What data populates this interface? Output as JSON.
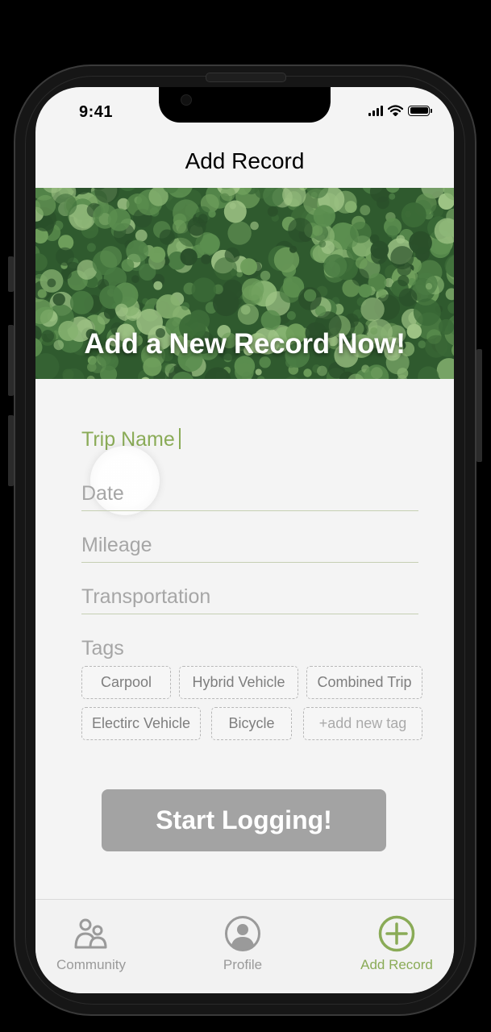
{
  "status_bar": {
    "time": "9:41"
  },
  "header": {
    "title": "Add Record"
  },
  "hero": {
    "title": "Add a New Record Now!"
  },
  "form": {
    "trip_name": {
      "placeholder": "Trip Name"
    },
    "date": {
      "placeholder": "Date"
    },
    "mileage": {
      "placeholder": "Mileage"
    },
    "transportation": {
      "placeholder": "Transportation"
    },
    "tags": {
      "label": "Tags",
      "items": [
        "Carpool",
        "Hybrid Vehicle",
        "Combined Trip",
        "Electirc Vehicle",
        "Bicycle"
      ],
      "add_label": "+add new tag"
    }
  },
  "cta": {
    "label": "Start Logging!"
  },
  "tab_bar": {
    "items": [
      {
        "label": "Community",
        "icon": "community-icon"
      },
      {
        "label": "Profile",
        "icon": "profile-icon"
      },
      {
        "label": "Add Record",
        "icon": "add-record-icon",
        "active": true
      }
    ]
  },
  "colors": {
    "accent": "#8aab57",
    "button_disabled": "#a3a3a3",
    "background": "#f4f4f4"
  }
}
